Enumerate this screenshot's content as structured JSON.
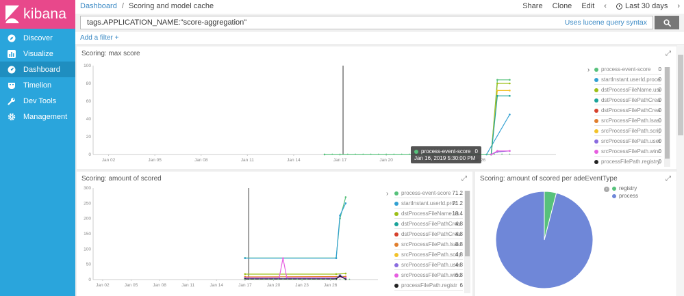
{
  "sidebar": {
    "logo_text": "kibana",
    "items": [
      {
        "label": "Discover",
        "icon": "compass-icon"
      },
      {
        "label": "Visualize",
        "icon": "bar-chart-icon"
      },
      {
        "label": "Dashboard",
        "icon": "dashboard-gauge-icon",
        "active": true
      },
      {
        "label": "Timelion",
        "icon": "timelion-mask-icon"
      },
      {
        "label": "Dev Tools",
        "icon": "wrench-icon"
      },
      {
        "label": "Management",
        "icon": "gear-icon"
      }
    ]
  },
  "breadcrumb": {
    "parent": "Dashboard",
    "separator": "/",
    "current": "Scoring and model cache"
  },
  "top_actions": {
    "share": "Share",
    "clone": "Clone",
    "edit": "Edit",
    "prev": "‹",
    "time_range": "Last 30 days",
    "next": "›"
  },
  "query": {
    "value": "tags.APPLICATION_NAME:\"score-aggregation\"",
    "syntax_link": "Uses lucene query syntax"
  },
  "filter": {
    "add_label": "Add a filter +"
  },
  "panels": {
    "max_score": {
      "title": "Scoring: max score",
      "legend": [
        {
          "name": "process-event-score",
          "value": "0",
          "color": "#57c17b"
        },
        {
          "name": "startInstant.userId.process",
          "value": "0",
          "color": "#31a0d2"
        },
        {
          "name": "dstProcessFileName.userId",
          "value": "0",
          "color": "#9cbf16"
        },
        {
          "name": "dstProcessFilePathCreated",
          "value": "0",
          "color": "#1aa39a"
        },
        {
          "name": "dstProcessFilePathCreated",
          "value": "0",
          "color": "#d6412c"
        },
        {
          "name": "srcProcessFilePath.lsass.pr",
          "value": "0",
          "color": "#e07d2c"
        },
        {
          "name": "srcProcessFilePath.scriptin",
          "value": "0",
          "color": "#f2c229"
        },
        {
          "name": "srcProcessFilePath.userId",
          "value": "0",
          "color": "#8a6bdf"
        },
        {
          "name": "srcProcessFilePath.window",
          "value": "0",
          "color": "#e65ee0"
        },
        {
          "name": "processFilePath.registry",
          "value": "0",
          "color": "#222222"
        }
      ],
      "tooltip": {
        "series": "process-event-score",
        "value": "0",
        "time": "Jan 16, 2019 5:30:00 PM"
      }
    },
    "amount_scored": {
      "title": "Scoring: amount of scored",
      "legend": [
        {
          "name": "process-event-score",
          "value": "71.2",
          "color": "#57c17b"
        },
        {
          "name": "startInstant.userId.proc",
          "value": "71.2",
          "color": "#31a0d2"
        },
        {
          "name": "dstProcessFileName.us",
          "value": "18.4",
          "color": "#9cbf16"
        },
        {
          "name": "dstProcessFilePathCreat",
          "value": "4.8",
          "color": "#1aa39a"
        },
        {
          "name": "dstProcessFilePathCreat",
          "value": "4.8",
          "color": "#d6412c"
        },
        {
          "name": "srcProcessFilePath.lsass",
          "value": "8.8",
          "color": "#e07d2c"
        },
        {
          "name": "srcProcessFilePath.script",
          "value": "4.8",
          "color": "#f2c229"
        },
        {
          "name": "srcProcessFilePath.userI",
          "value": "4.8",
          "color": "#8a6bdf"
        },
        {
          "name": "srcProcessFilePath.windc",
          "value": "6.8",
          "color": "#e65ee0"
        },
        {
          "name": "processFilePath.registr",
          "value": "6",
          "color": "#222222"
        }
      ]
    },
    "per_event_type": {
      "title": "Scoring: amount of scored per adeEventType",
      "legend": [
        {
          "name": "registry",
          "color": "#57c17b"
        },
        {
          "name": "process",
          "color": "#6f87d8"
        }
      ]
    }
  },
  "chart_data": [
    {
      "type": "line",
      "title": "Scoring: max score",
      "x_ticks": [
        "Jan 02",
        "Jan 05",
        "Jan 08",
        "Jan 11",
        "Jan 14",
        "Jan 17",
        "Jan 20",
        "Jan 23",
        "Jan 26"
      ],
      "ylim": [
        0,
        100
      ],
      "y_ticks": [
        0,
        20,
        40,
        60,
        80,
        100
      ],
      "x_range_days": [
        0,
        30
      ],
      "series": [
        {
          "name": "process-event-score",
          "color": "#57c17b",
          "points": [
            [
              15,
              0
            ],
            [
              25.8,
              0
            ],
            [
              26.2,
              84
            ],
            [
              27,
              84
            ]
          ]
        },
        {
          "name": "startInstant.userId.process",
          "color": "#31a0d2",
          "points": [
            [
              25.5,
              0
            ],
            [
              27,
              45
            ]
          ]
        },
        {
          "name": "dstProcessFileName.userId",
          "color": "#9cbf16",
          "points": [
            [
              25.8,
              0
            ],
            [
              26.2,
              80
            ],
            [
              27,
              80
            ]
          ]
        },
        {
          "name": "srcProcessFilePath.scriptin",
          "color": "#f2c229",
          "points": [
            [
              25.8,
              0
            ],
            [
              26.2,
              72
            ],
            [
              27,
              72
            ]
          ]
        },
        {
          "name": "dstProcessFilePathCreated",
          "color": "#1aa39a",
          "points": [
            [
              25.8,
              0
            ],
            [
              26.2,
              66
            ],
            [
              27,
              66
            ]
          ]
        },
        {
          "name": "srcProcessFilePath.userId",
          "color": "#8a6bdf",
          "points": [
            [
              25.8,
              0
            ],
            [
              26.2,
              3
            ],
            [
              27,
              4
            ]
          ]
        },
        {
          "name": "srcProcessFilePath.window",
          "color": "#e65ee0",
          "points": [
            [
              25.8,
              0
            ],
            [
              26.2,
              4
            ],
            [
              27,
              4
            ]
          ]
        }
      ]
    },
    {
      "type": "line",
      "title": "Scoring: amount of scored",
      "x_ticks": [
        "Jan 02",
        "Jan 05",
        "Jan 08",
        "Jan 11",
        "Jan 14",
        "Jan 17",
        "Jan 20",
        "Jan 23",
        "Jan 26"
      ],
      "ylim": [
        0,
        300
      ],
      "y_ticks": [
        0,
        50,
        100,
        150,
        200,
        250,
        300
      ],
      "x_range_days": [
        0,
        30
      ],
      "series": [
        {
          "name": "process-event-score",
          "color": "#57c17b",
          "points": [
            [
              16,
              71
            ],
            [
              25.6,
              71
            ],
            [
              26,
              200
            ],
            [
              26.6,
              270
            ]
          ]
        },
        {
          "name": "startInstant.userId.proc",
          "color": "#31a0d2",
          "points": [
            [
              16,
              70
            ],
            [
              25.6,
              70
            ],
            [
              26,
              210
            ],
            [
              26.6,
              250
            ]
          ]
        },
        {
          "name": "dstProcessFileName.us",
          "color": "#9cbf16",
          "points": [
            [
              16,
              18
            ],
            [
              25.6,
              18
            ],
            [
              26.6,
              20
            ]
          ]
        },
        {
          "name": "srcProcessFilePath.lsass",
          "color": "#e07d2c",
          "points": [
            [
              16,
              9
            ],
            [
              26.6,
              10
            ]
          ]
        },
        {
          "name": "srcProcessFilePath.windc",
          "color": "#e65ee0",
          "points": [
            [
              16,
              6
            ],
            [
              19.6,
              6
            ],
            [
              20,
              70
            ],
            [
              20.4,
              6
            ],
            [
              26.6,
              6
            ]
          ]
        },
        {
          "name": "srcProcessFilePath.userI",
          "color": "#8a6bdf",
          "points": [
            [
              16,
              4
            ],
            [
              25.6,
              4
            ],
            [
              26,
              15
            ],
            [
              26.6,
              2
            ]
          ]
        },
        {
          "name": "processFilePath.registr",
          "color": "#222222",
          "points": [
            [
              16,
              2
            ],
            [
              25.6,
              2
            ],
            [
              26,
              12
            ],
            [
              26.6,
              1
            ]
          ]
        }
      ]
    },
    {
      "type": "pie",
      "title": "Scoring: amount of scored per adeEventType",
      "slices": [
        {
          "label": "registry",
          "value": 4,
          "color": "#57c17b"
        },
        {
          "label": "process",
          "value": 96,
          "color": "#6f87d8"
        }
      ]
    }
  ]
}
